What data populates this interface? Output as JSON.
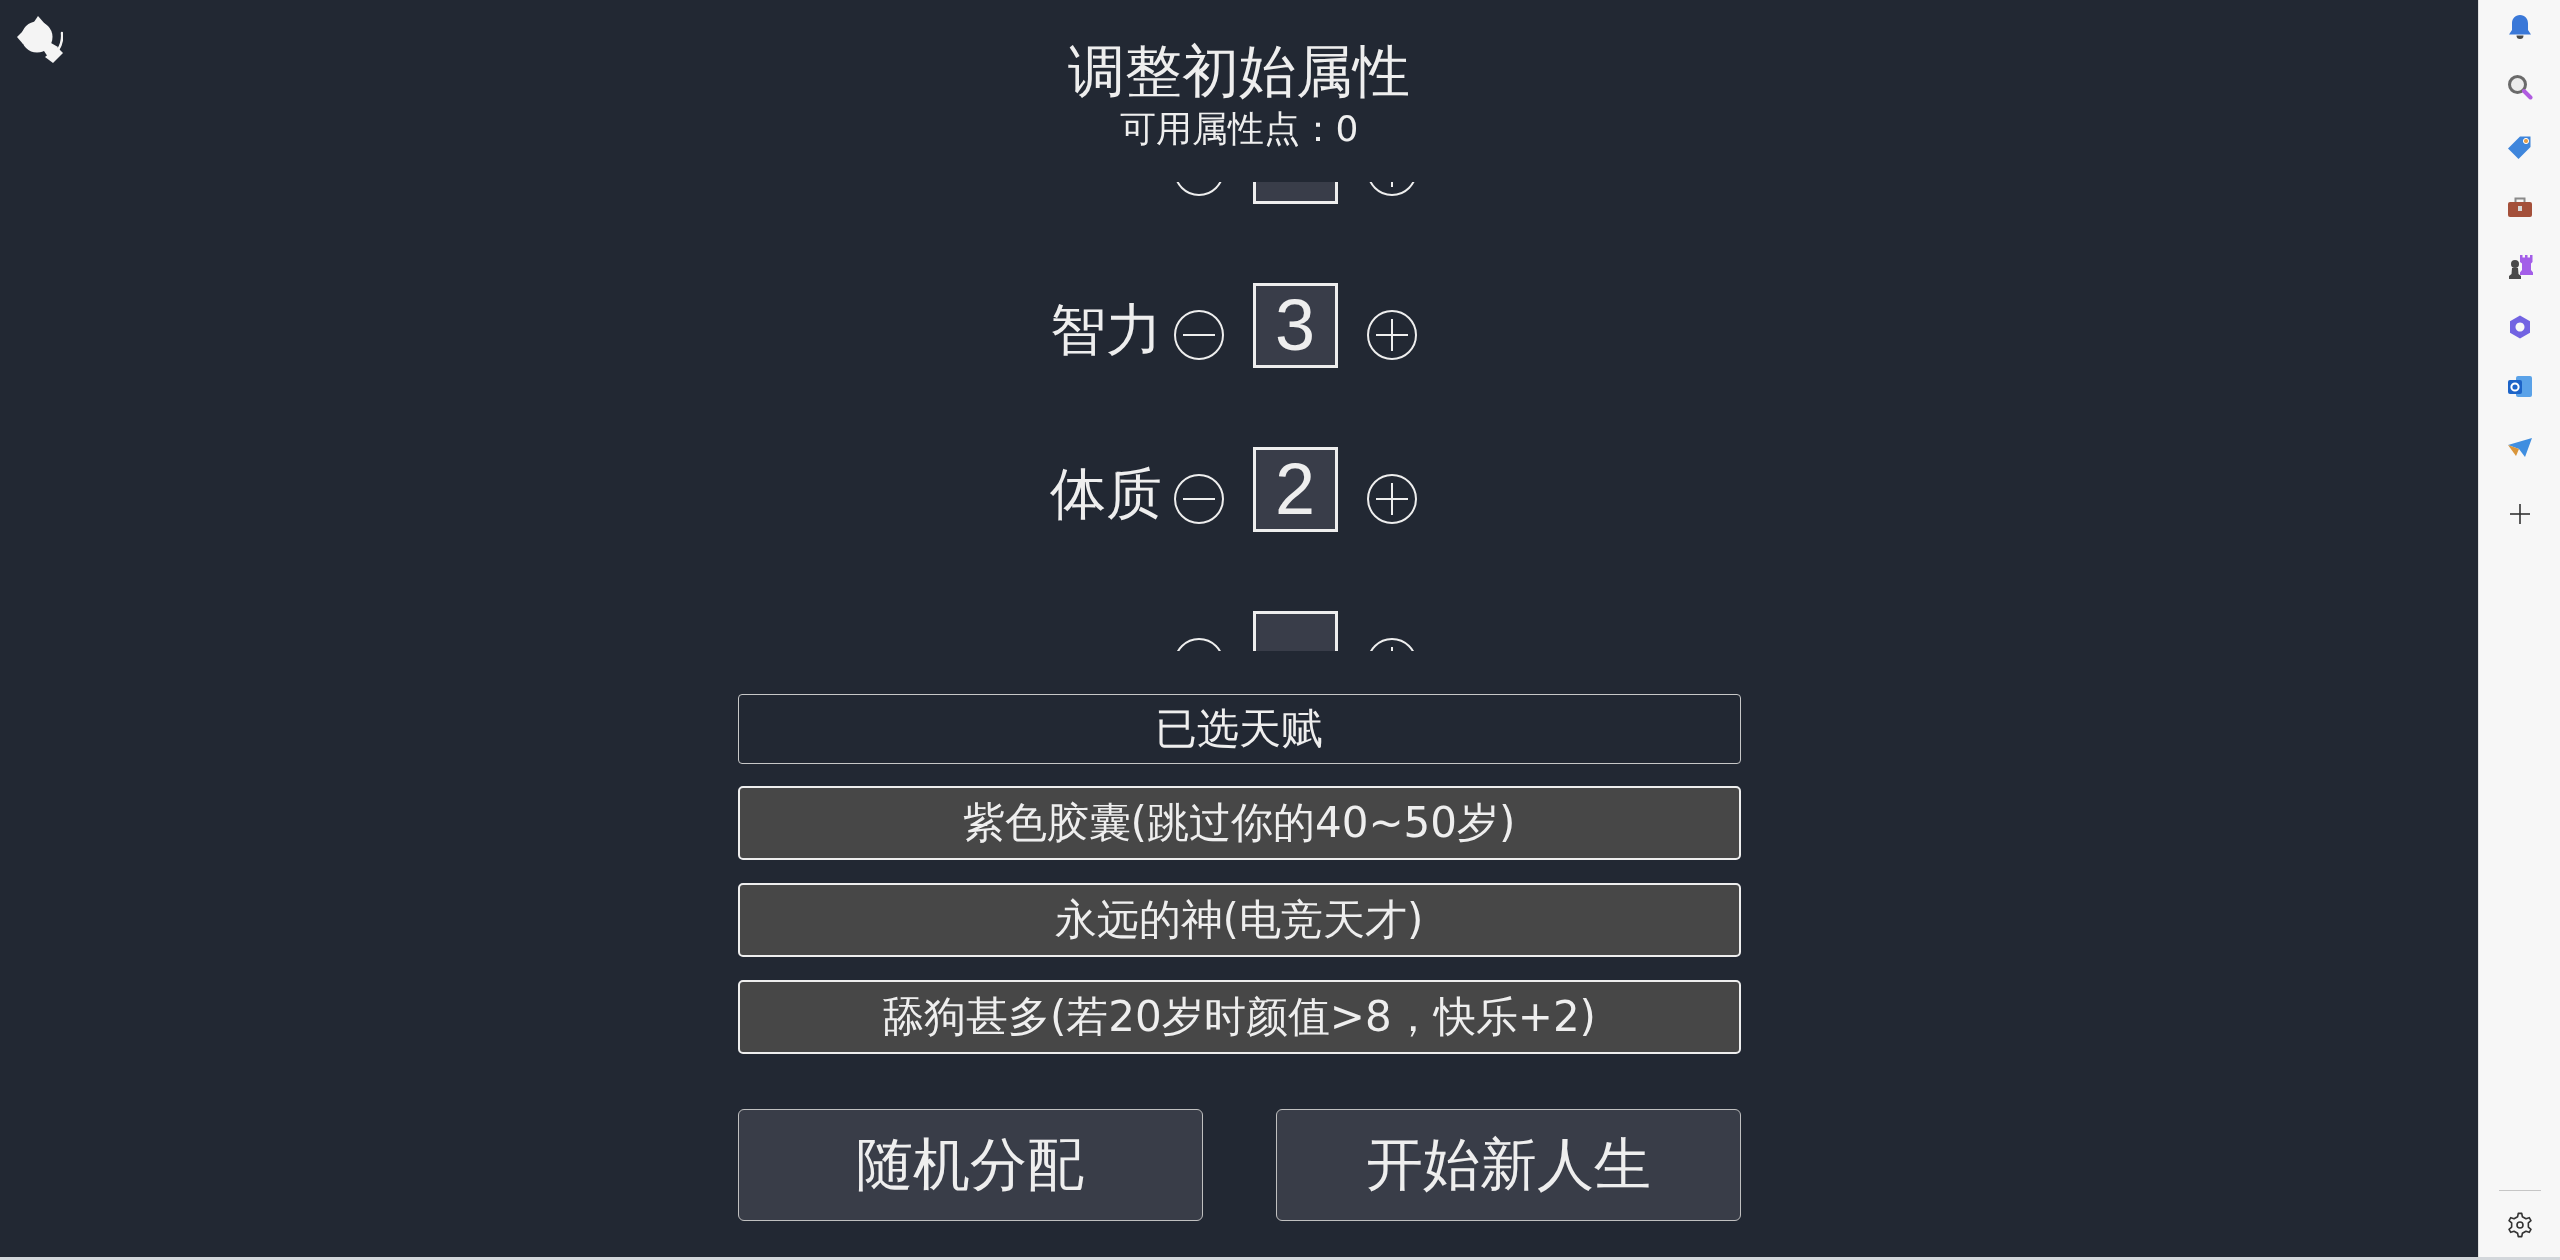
{
  "header": {
    "title": "调整初始属性",
    "available_points": "可用属性点：0"
  },
  "attribute_list": {
    "clipped_row_above": true,
    "rows": [
      {
        "name": "智力",
        "value": "3"
      },
      {
        "name": "体质",
        "value": "2"
      }
    ],
    "clipped_row_below": true
  },
  "talents": {
    "title": "已选天赋",
    "items": [
      "紫色胶囊(跳过你的40~50岁)",
      "永远的神(电竞天才)",
      "舔狗甚多(若20岁时颜值>8，快乐+2)"
    ]
  },
  "actions": [
    "随机分配",
    "开始新人生"
  ]
}
